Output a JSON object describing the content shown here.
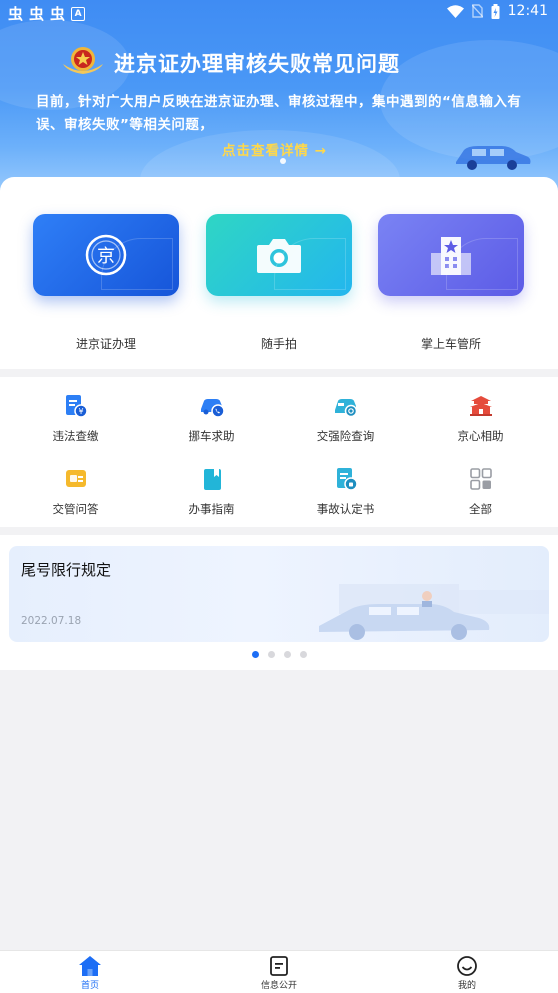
{
  "status_bar": {
    "left_glyphs": [
      "虫",
      "虫",
      "虫"
    ],
    "left_badge": "A",
    "time": "12:41"
  },
  "banner": {
    "title": "进京证办理审核失败常见问题",
    "description": "目前，针对广大用户反映在进京证办理、审核过程中，集中遇到的“信息输入有误、审核失败”等相关问题，",
    "detail_link": "点击查看详情 →"
  },
  "main_services": [
    {
      "label": "进京证办理",
      "icon": "jing-badge-icon"
    },
    {
      "label": "随手拍",
      "icon": "camera-icon"
    },
    {
      "label": "掌上车管所",
      "icon": "building-icon"
    }
  ],
  "services": [
    {
      "label": "违法查缴",
      "icon": "fine-document-icon"
    },
    {
      "label": "挪车求助",
      "icon": "car-phone-icon"
    },
    {
      "label": "交强险查询",
      "icon": "car-search-icon"
    },
    {
      "label": "京心相助",
      "icon": "tiananmen-icon"
    },
    {
      "label": "交管问答",
      "icon": "qa-icon"
    },
    {
      "label": "办事指南",
      "icon": "guide-book-icon"
    },
    {
      "label": "事故认定书",
      "icon": "accident-document-icon"
    },
    {
      "label": "全部",
      "icon": "grid-icon"
    }
  ],
  "news": {
    "title": "尾号限行规定",
    "date": "2022.07.18",
    "carousel_count": 4,
    "active_index": 0
  },
  "tabs": [
    {
      "label": "首页",
      "icon": "home-icon",
      "active": true
    },
    {
      "label": "信息公开",
      "icon": "document-icon",
      "active": false
    },
    {
      "label": "我的",
      "icon": "smiley-icon",
      "active": false
    }
  ],
  "colors": {
    "accent": "#1d6ef5",
    "banner": "#4a98f6",
    "detail_link": "#ffd84a"
  }
}
